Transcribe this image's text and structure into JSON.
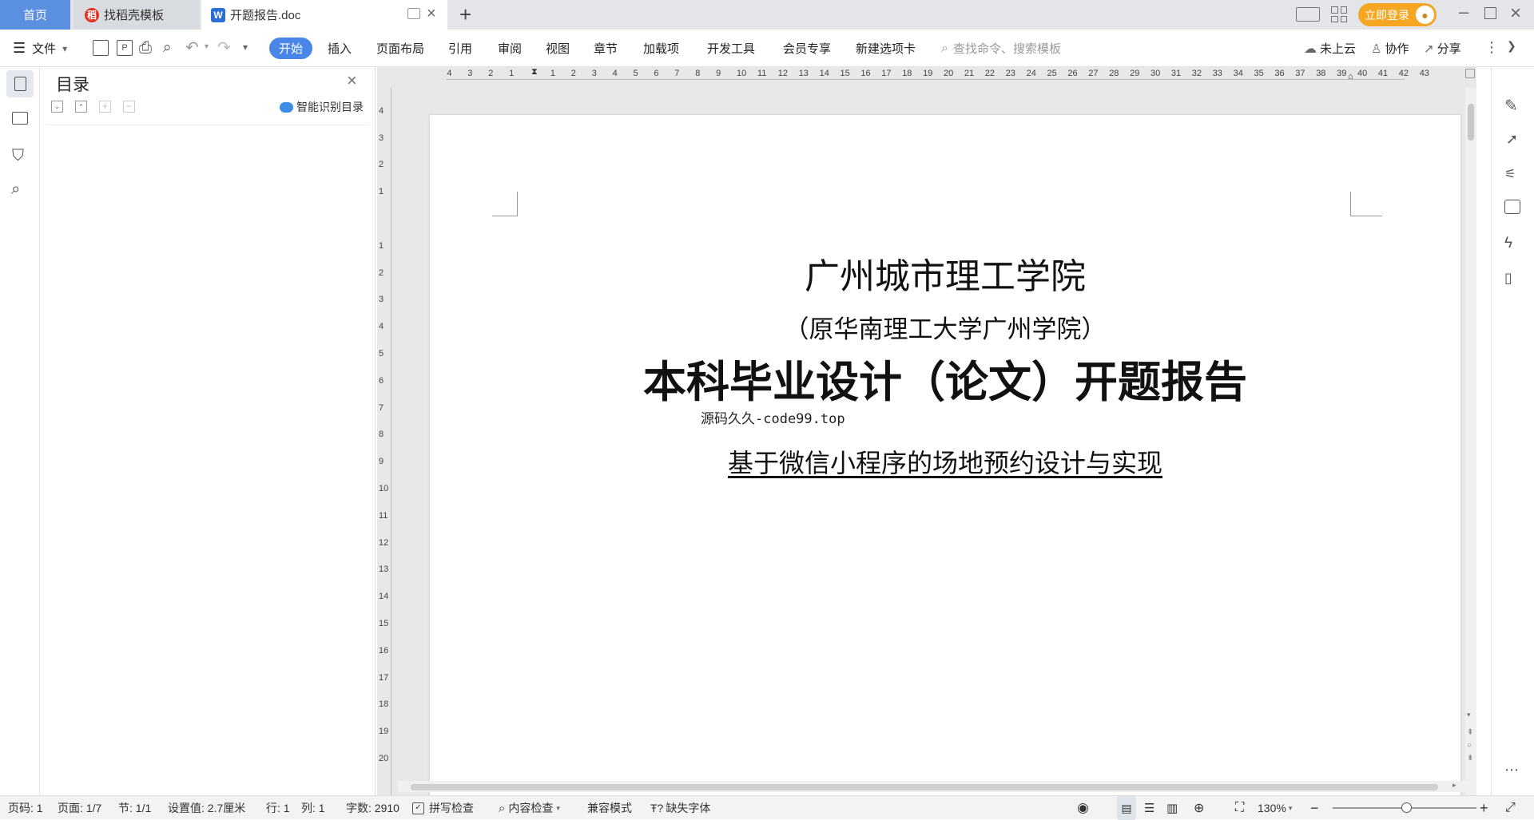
{
  "tabs": {
    "home": "首页",
    "templates": "找稻壳模板",
    "document": "开题报告.doc",
    "login": "立即登录"
  },
  "menu": {
    "file": "文件",
    "items": [
      "开始",
      "插入",
      "页面布局",
      "引用",
      "审阅",
      "视图",
      "章节",
      "加载项",
      "开发工具",
      "会员专享",
      "新建选项卡"
    ],
    "search_placeholder": "查找命令、搜索模板",
    "cloud": "未上云",
    "collab": "协作",
    "share": "分享"
  },
  "toc": {
    "title": "目录",
    "smart": "智能识别目录"
  },
  "ruler": {
    "h_left": [
      "4",
      "3",
      "2",
      "1"
    ],
    "h_right": [
      "1",
      "2",
      "3",
      "4",
      "5",
      "6",
      "7",
      "8",
      "9",
      "10",
      "11",
      "12",
      "13",
      "14",
      "15",
      "16",
      "17",
      "18",
      "19",
      "20",
      "21",
      "22",
      "23",
      "24",
      "25",
      "26",
      "27",
      "28",
      "29",
      "30",
      "31",
      "32",
      "33",
      "34",
      "35",
      "36",
      "37",
      "38",
      "39",
      "40",
      "41",
      "42",
      "43"
    ],
    "v_top": [
      "4",
      "3",
      "2",
      "1"
    ],
    "v_bottom": [
      "1",
      "2",
      "3",
      "4",
      "5",
      "6",
      "7",
      "8",
      "9",
      "10",
      "11",
      "12",
      "13",
      "14",
      "15",
      "16",
      "17",
      "18",
      "19",
      "20"
    ]
  },
  "document": {
    "school": "广州城市理工学院",
    "former_name": "（原华南理工大学广州学院）",
    "report_title": "本科毕业设计（论文）开题报告",
    "source_note": "源码久久-code99.top",
    "thesis_title": "基于微信小程序的场地预约设计与实现"
  },
  "status": {
    "page_code": "页码: 1",
    "pages": "页面: 1/7",
    "section": "节: 1/1",
    "setting": "设置值: 2.7厘米",
    "row": "行: 1",
    "col": "列: 1",
    "words": "字数: 2910",
    "spell": "拼写检查",
    "content_check": "内容检查",
    "compat": "兼容模式",
    "missing_font": "缺失字体",
    "zoom": "130%"
  },
  "colors": {
    "accent": "#4a86e8",
    "login": "#f5a623",
    "tab_home": "#5b8fe0"
  }
}
